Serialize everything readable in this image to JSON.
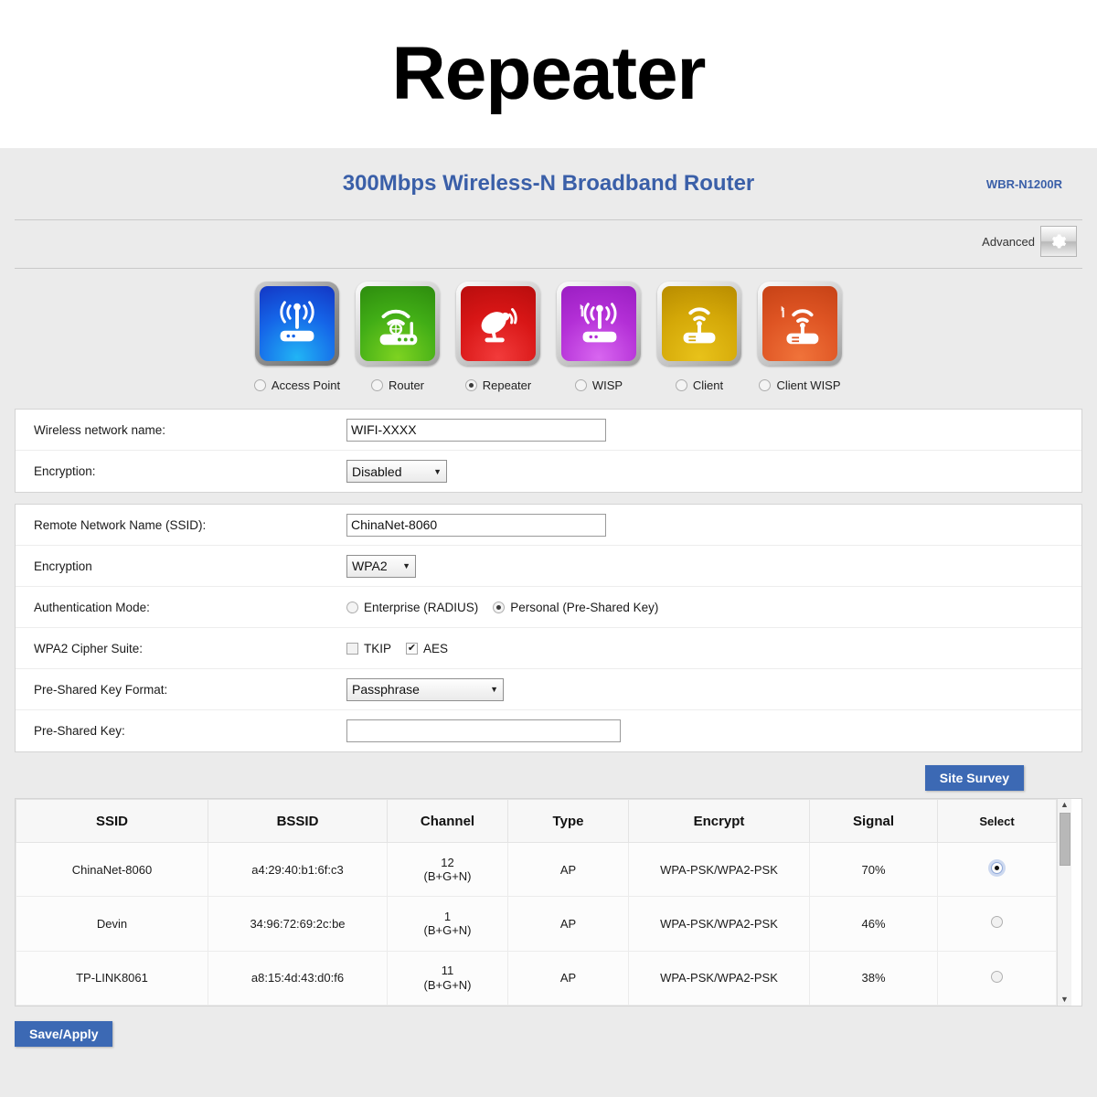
{
  "banner": {
    "title": "Repeater"
  },
  "header": {
    "product_title": "300Mbps Wireless-N Broadband Router",
    "model": "WBR-N1200R",
    "advanced_label": "Advanced",
    "advanced_icon": "gear-icon",
    "accent_color": "#3a5fa8"
  },
  "modes": {
    "selected": "Repeater",
    "items": [
      {
        "label": "Access Point",
        "icon": "access-point-icon",
        "color": "#1565e8",
        "selected": false
      },
      {
        "label": "Router",
        "icon": "router-icon",
        "color": "#41ad16",
        "selected": false
      },
      {
        "label": "Repeater",
        "icon": "satellite-dish-icon",
        "color": "#d81616",
        "selected": true
      },
      {
        "label": "WISP",
        "icon": "wisp-icon",
        "color": "#b32fd6",
        "selected": false
      },
      {
        "label": "Client",
        "icon": "client-icon",
        "color": "#d4a808",
        "selected": false
      },
      {
        "label": "Client WISP",
        "icon": "client-wisp-icon",
        "color": "#de5423",
        "selected": false
      }
    ]
  },
  "local_wireless": {
    "network_name_label": "Wireless network name:",
    "network_name_value": "WIFI-XXXX",
    "encryption_label": "Encryption:",
    "encryption_value": "Disabled"
  },
  "remote_wireless": {
    "ssid_label": "Remote Network Name (SSID):",
    "ssid_value": "ChinaNet-8060",
    "encryption_label": "Encryption",
    "encryption_value": "WPA2",
    "auth_mode_label": "Authentication Mode:",
    "auth_enterprise_label": "Enterprise (RADIUS)",
    "auth_enterprise_selected": false,
    "auth_personal_label": "Personal (Pre-Shared Key)",
    "auth_personal_selected": true,
    "cipher_label": "WPA2 Cipher Suite:",
    "cipher_tkip_label": "TKIP",
    "cipher_tkip_checked": false,
    "cipher_aes_label": "AES",
    "cipher_aes_checked": true,
    "psk_format_label": "Pre-Shared Key Format:",
    "psk_format_value": "Passphrase",
    "psk_label": "Pre-Shared Key:",
    "psk_value": ""
  },
  "survey": {
    "button_label": "Site Survey",
    "button_color": "#3c69b4",
    "columns": [
      "SSID",
      "BSSID",
      "Channel",
      "Type",
      "Encrypt",
      "Signal",
      "Select"
    ],
    "rows": [
      {
        "ssid": "ChinaNet-8060",
        "bssid": "a4:29:40:b1:6f:c3",
        "channel_number": "12",
        "channel_band": "(B+G+N)",
        "type": "AP",
        "encrypt": "WPA-PSK/WPA2-PSK",
        "signal": "70%",
        "selected": true
      },
      {
        "ssid": "Devin",
        "bssid": "34:96:72:69:2c:be",
        "channel_number": "1",
        "channel_band": "(B+G+N)",
        "type": "AP",
        "encrypt": "WPA-PSK/WPA2-PSK",
        "signal": "46%",
        "selected": false
      },
      {
        "ssid": "TP-LINK8061",
        "bssid": "a8:15:4d:43:d0:f6",
        "channel_number": "11",
        "channel_band": "(B+G+N)",
        "type": "AP",
        "encrypt": "WPA-PSK/WPA2-PSK",
        "signal": "38%",
        "selected": false
      }
    ]
  },
  "footer": {
    "save_label": "Save/Apply",
    "save_color": "#3c69b4"
  }
}
